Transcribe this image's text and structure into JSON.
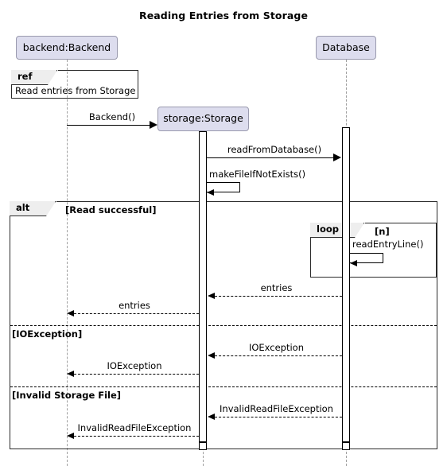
{
  "diagram": {
    "title": "Reading Entries from Storage",
    "type": "uml-sequence-diagram"
  },
  "participants": [
    {
      "id": "backend",
      "label": "backend:Backend"
    },
    {
      "id": "storage",
      "label": "storage:Storage"
    },
    {
      "id": "database",
      "label": "Database"
    }
  ],
  "ref_fragment": {
    "operator": "ref",
    "body": "Read entries from Storage"
  },
  "messages": [
    {
      "id": "m1",
      "label": "Backend()",
      "from": "backend",
      "to": "storage",
      "kind": "synchronous"
    },
    {
      "id": "m2",
      "label": "readFromDatabase()",
      "from": "storage",
      "to": "database",
      "kind": "synchronous"
    },
    {
      "id": "m3",
      "label": "makeFileIfNotExists()",
      "from": "storage",
      "to": "storage",
      "kind": "self"
    },
    {
      "id": "m4",
      "label": "readEntryLine()",
      "from": "database",
      "to": "database",
      "kind": "self"
    },
    {
      "id": "m5",
      "label": "entries",
      "from": "database",
      "to": "storage",
      "kind": "return"
    },
    {
      "id": "m6",
      "label": "entries",
      "from": "storage",
      "to": "backend",
      "kind": "return"
    },
    {
      "id": "m7",
      "label": "IOException",
      "from": "database",
      "to": "storage",
      "kind": "return"
    },
    {
      "id": "m8",
      "label": "IOException",
      "from": "storage",
      "to": "backend",
      "kind": "return"
    },
    {
      "id": "m9",
      "label": "InvalidReadFileException",
      "from": "database",
      "to": "storage",
      "kind": "return"
    },
    {
      "id": "m10",
      "label": "InvalidReadFileException",
      "from": "storage",
      "to": "backend",
      "kind": "return"
    }
  ],
  "fragments": {
    "alt": {
      "operator": "alt",
      "guards": [
        "[Read successful]",
        "[IOException]",
        "[Invalid Storage File]"
      ]
    },
    "loop": {
      "operator": "loop",
      "guard": "[n]"
    }
  },
  "colors": {
    "participant_fill": "#DDDDEE",
    "participant_border": "#9A9AAE",
    "lifeline": "#A0A0A0",
    "frame_border": "#2B2B2B",
    "tab_fill": "#EEEEEE",
    "text": "#000000",
    "background": "#FFFFFF"
  }
}
